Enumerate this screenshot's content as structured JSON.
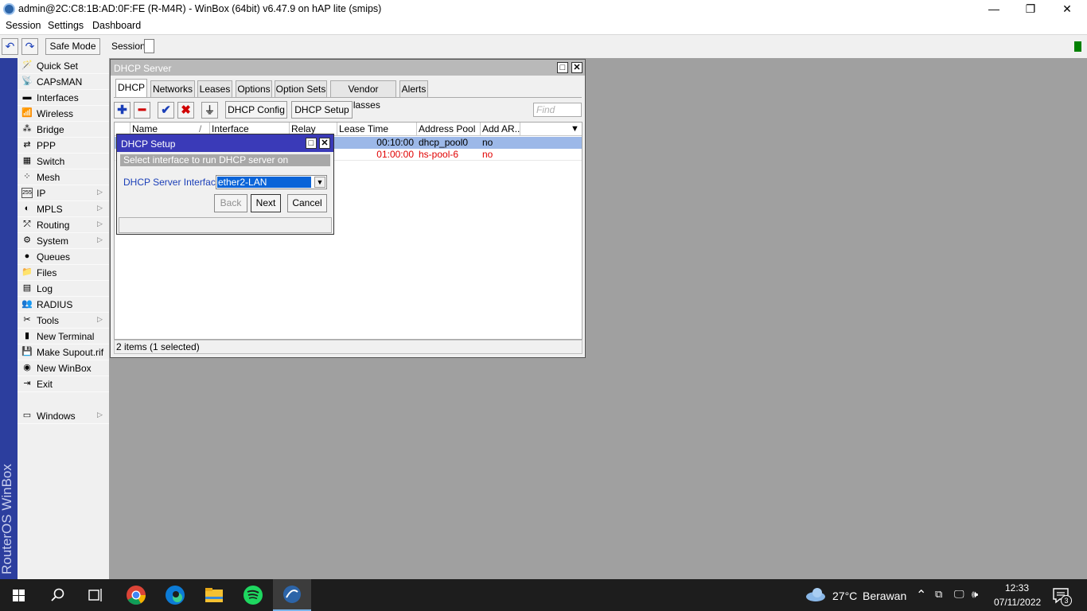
{
  "window": {
    "title": "admin@2C:C8:1B:AD:0F:FE (R-M4R) - WinBox (64bit) v6.47.9 on hAP lite (smips)",
    "minimize": "—",
    "maximize": "❐",
    "close": "✕"
  },
  "menu": {
    "session": "Session",
    "settings": "Settings",
    "dashboard": "Dashboard"
  },
  "toolbar": {
    "undo": "↶",
    "redo": "↷",
    "safe_mode": "Safe Mode",
    "session_label": "Session:"
  },
  "brand": "RouterOS WinBox",
  "sidebar": [
    {
      "label": "Quick Set",
      "icon": "🪄",
      "arrow": false
    },
    {
      "label": "CAPsMAN",
      "icon": "📡",
      "arrow": false
    },
    {
      "label": "Interfaces",
      "icon": "▬",
      "arrow": false
    },
    {
      "label": "Wireless",
      "icon": "📶",
      "arrow": false
    },
    {
      "label": "Bridge",
      "icon": "⁂",
      "arrow": false
    },
    {
      "label": "PPP",
      "icon": "⇄",
      "arrow": false
    },
    {
      "label": "Switch",
      "icon": "▦",
      "arrow": false
    },
    {
      "label": "Mesh",
      "icon": "⁘",
      "arrow": false
    },
    {
      "label": "IP",
      "icon": "255",
      "arrow": true
    },
    {
      "label": "MPLS",
      "icon": "◐",
      "arrow": true
    },
    {
      "label": "Routing",
      "icon": "⤱",
      "arrow": true
    },
    {
      "label": "System",
      "icon": "⚙",
      "arrow": true
    },
    {
      "label": "Queues",
      "icon": "●",
      "arrow": false
    },
    {
      "label": "Files",
      "icon": "📁",
      "arrow": false
    },
    {
      "label": "Log",
      "icon": "▤",
      "arrow": false
    },
    {
      "label": "RADIUS",
      "icon": "👥",
      "arrow": false
    },
    {
      "label": "Tools",
      "icon": "✂",
      "arrow": true
    },
    {
      "label": "New Terminal",
      "icon": "▮",
      "arrow": false
    },
    {
      "label": "Make Supout.rif",
      "icon": "💾",
      "arrow": false
    },
    {
      "label": "New WinBox",
      "icon": "◉",
      "arrow": false
    },
    {
      "label": "Exit",
      "icon": "⇥",
      "arrow": false
    },
    {
      "label": "Windows",
      "icon": "▭",
      "arrow": true
    }
  ],
  "dhcp_window": {
    "title": "DHCP Server",
    "tabs": [
      "DHCP",
      "Networks",
      "Leases",
      "Options",
      "Option Sets",
      "Vendor Classes",
      "Alerts"
    ],
    "buttons": {
      "add": "✚",
      "remove": "━",
      "enable": "✔",
      "disable": "✖",
      "filter": "⏚",
      "dhcp_config": "DHCP Config",
      "dhcp_setup": "DHCP Setup"
    },
    "find_placeholder": "Find",
    "columns": [
      "Name",
      "Interface",
      "Relay",
      "Lease Time",
      "Address Pool",
      "Add AR..."
    ],
    "sort_marker": "/",
    "rows": [
      {
        "lease_time": "00:10:00",
        "address_pool": "dhcp_pool0",
        "add_arp": "no",
        "color": "#000000",
        "selected": true
      },
      {
        "lease_time": "01:00:00",
        "address_pool": "hs-pool-6",
        "add_arp": "no",
        "color": "#e00000",
        "selected": false
      }
    ],
    "status": "2 items (1 selected)"
  },
  "setup_dialog": {
    "title": "DHCP Setup",
    "hint": "Select interface to run DHCP server on",
    "field_label": "DHCP Server Interface:",
    "field_value": "ether2-LAN",
    "back": "Back",
    "next": "Next",
    "cancel": "Cancel"
  },
  "taskbar": {
    "weather_temp": "27°C",
    "weather_text": "Berawan",
    "time": "12:33",
    "date": "07/11/2022",
    "notifications": "3"
  },
  "colors": {
    "brand_blue": "#2c3e9e",
    "dialog_title": "#3a3ab8",
    "selected_row": "#9cb8e8",
    "label_blue": "#1b3fb8"
  }
}
